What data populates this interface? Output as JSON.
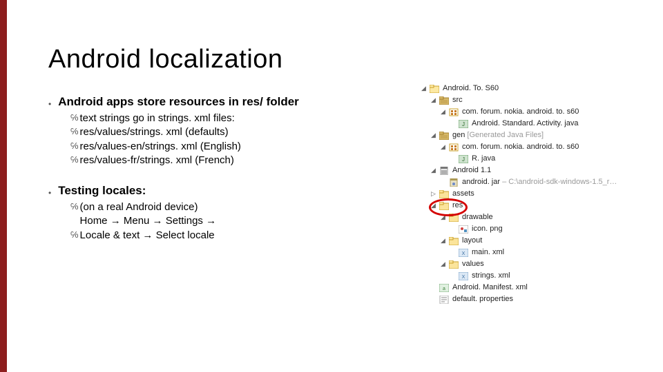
{
  "title": "Android localization",
  "section1": {
    "head": "Android apps store resources in res/ folder",
    "items": [
      "text strings go in strings. xml files:",
      "res/values/strings. xml  (defaults)",
      "res/values-en/strings. xml  (English)",
      "res/values-fr/strings. xml  (French)"
    ]
  },
  "section2": {
    "head": "Testing locales:",
    "items": [
      "(on a real Android device)",
      "Home → Menu → Settings →",
      "Locale & text → Select locale"
    ]
  },
  "tree": [
    {
      "indent": 0,
      "twisty": "open",
      "icon": "project",
      "label": "Android. To. S60"
    },
    {
      "indent": 1,
      "twisty": "open",
      "icon": "srcfolder",
      "label": "src"
    },
    {
      "indent": 2,
      "twisty": "open",
      "icon": "package",
      "label": "com. forum. nokia. android. to. s60"
    },
    {
      "indent": 3,
      "twisty": "none",
      "icon": "java",
      "label": "Android. Standard. Activity. java"
    },
    {
      "indent": 1,
      "twisty": "open",
      "icon": "srcfolder",
      "label": "gen",
      "suffix": " [Generated Java Files]"
    },
    {
      "indent": 2,
      "twisty": "open",
      "icon": "package",
      "label": "com. forum. nokia. android. to. s60"
    },
    {
      "indent": 3,
      "twisty": "none",
      "icon": "java",
      "label": "R. java"
    },
    {
      "indent": 1,
      "twisty": "open",
      "icon": "jar",
      "label": "Android 1.1"
    },
    {
      "indent": 2,
      "twisty": "none",
      "icon": "jarfile",
      "label": "android. jar",
      "suffix": " – C:\\android-sdk-windows-1.5_r…"
    },
    {
      "indent": 1,
      "twisty": "closed",
      "icon": "folder",
      "label": "assets"
    },
    {
      "indent": 1,
      "twisty": "open",
      "icon": "folder",
      "label": "res"
    },
    {
      "indent": 2,
      "twisty": "open",
      "icon": "folder",
      "label": "drawable"
    },
    {
      "indent": 3,
      "twisty": "none",
      "icon": "image",
      "label": "icon. png"
    },
    {
      "indent": 2,
      "twisty": "open",
      "icon": "folder",
      "label": "layout"
    },
    {
      "indent": 3,
      "twisty": "none",
      "icon": "xml",
      "label": "main. xml"
    },
    {
      "indent": 2,
      "twisty": "open",
      "icon": "folder",
      "label": "values"
    },
    {
      "indent": 3,
      "twisty": "none",
      "icon": "xml",
      "label": "strings. xml"
    },
    {
      "indent": 1,
      "twisty": "none",
      "icon": "manifest",
      "label": "Android. Manifest. xml"
    },
    {
      "indent": 1,
      "twisty": "none",
      "icon": "propfile",
      "label": "default. properties"
    }
  ]
}
